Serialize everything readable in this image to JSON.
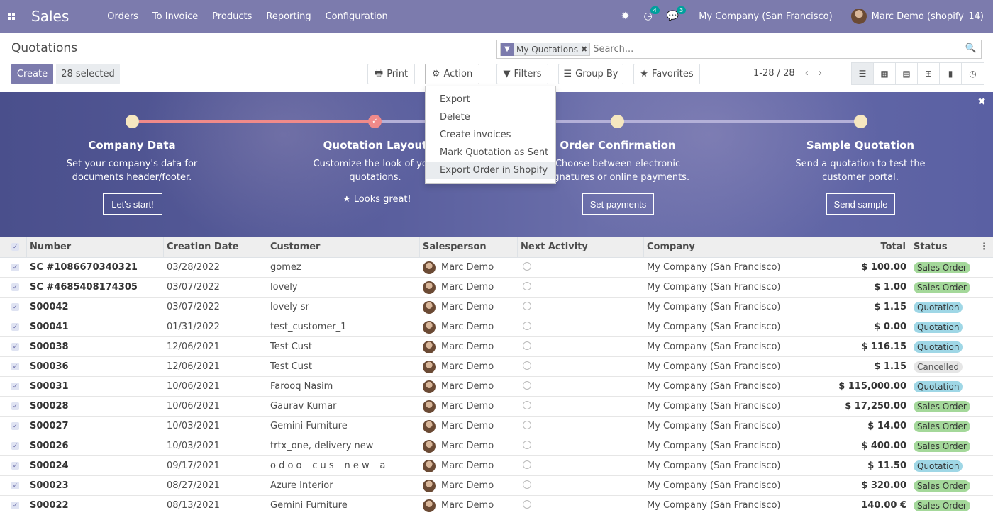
{
  "nav": {
    "app": "Sales",
    "menu": [
      "Orders",
      "To Invoice",
      "Products",
      "Reporting",
      "Configuration"
    ],
    "activity_count": "4",
    "message_count": "3",
    "company": "My Company (San Francisco)",
    "user": "Marc Demo (shopify_14)"
  },
  "control": {
    "title": "Quotations",
    "create": "Create",
    "selected": "28 selected",
    "print": "Print",
    "action": "Action",
    "filters": "Filters",
    "group_by": "Group By",
    "favorites": "Favorites",
    "pager": "1-28 / 28",
    "search_facet": "My Quotations",
    "search_placeholder": "Search..."
  },
  "action_menu": [
    "Export",
    "Delete",
    "Create invoices",
    "Mark Quotation as Sent",
    "Export Order in Shopify"
  ],
  "banner": {
    "steps": [
      {
        "title": "Company Data",
        "desc1": "Set your company's data for",
        "desc2": "documents header/footer.",
        "button": "Let's start!"
      },
      {
        "title": "Quotation Layout",
        "desc1": "Customize the look of your",
        "desc2": "quotations.",
        "done": "Looks great!"
      },
      {
        "title": "Order Confirmation",
        "desc1": "Choose between electronic",
        "desc2": "signatures or online payments.",
        "button": "Set payments"
      },
      {
        "title": "Sample Quotation",
        "desc1": "Send a quotation to test the",
        "desc2": "customer portal.",
        "button": "Send sample"
      }
    ]
  },
  "table": {
    "headers": [
      "Number",
      "Creation Date",
      "Customer",
      "Salesperson",
      "Next Activity",
      "Company",
      "Total",
      "Status"
    ],
    "rows": [
      {
        "number": "SC #1086670340321",
        "date": "03/28/2022",
        "customer": "gomez",
        "salesperson": "Marc Demo",
        "company": "My Company (San Francisco)",
        "total": "$ 100.00",
        "status": "Sales Order"
      },
      {
        "number": "SC #4685408174305",
        "date": "03/07/2022",
        "customer": "lovely",
        "salesperson": "Marc Demo",
        "company": "My Company (San Francisco)",
        "total": "$ 1.00",
        "status": "Sales Order"
      },
      {
        "number": "S00042",
        "date": "03/07/2022",
        "customer": "lovely sr",
        "salesperson": "Marc Demo",
        "company": "My Company (San Francisco)",
        "total": "$ 1.15",
        "status": "Quotation"
      },
      {
        "number": "S00041",
        "date": "01/31/2022",
        "customer": "test_customer_1",
        "salesperson": "Marc Demo",
        "company": "My Company (San Francisco)",
        "total": "$ 0.00",
        "status": "Quotation"
      },
      {
        "number": "S00038",
        "date": "12/06/2021",
        "customer": "Test Cust",
        "salesperson": "Marc Demo",
        "company": "My Company (San Francisco)",
        "total": "$ 116.15",
        "status": "Quotation"
      },
      {
        "number": "S00036",
        "date": "12/06/2021",
        "customer": "Test Cust",
        "salesperson": "Marc Demo",
        "company": "My Company (San Francisco)",
        "total": "$ 1.15",
        "status": "Cancelled"
      },
      {
        "number": "S00031",
        "date": "10/06/2021",
        "customer": "Farooq Nasim",
        "salesperson": "Marc Demo",
        "company": "My Company (San Francisco)",
        "total": "$ 115,000.00",
        "status": "Quotation"
      },
      {
        "number": "S00028",
        "date": "10/06/2021",
        "customer": "Gaurav Kumar",
        "salesperson": "Marc Demo",
        "company": "My Company (San Francisco)",
        "total": "$ 17,250.00",
        "status": "Sales Order"
      },
      {
        "number": "S00027",
        "date": "10/03/2021",
        "customer": "Gemini Furniture",
        "salesperson": "Marc Demo",
        "company": "My Company (San Francisco)",
        "total": "$ 14.00",
        "status": "Sales Order"
      },
      {
        "number": "S00026",
        "date": "10/03/2021",
        "customer": "trtx_one, delivery new",
        "salesperson": "Marc Demo",
        "company": "My Company (San Francisco)",
        "total": "$ 400.00",
        "status": "Sales Order"
      },
      {
        "number": "S00024",
        "date": "09/17/2021",
        "customer": "o d o o _ c u s _ n e w _ a",
        "salesperson": "Marc Demo",
        "company": "My Company (San Francisco)",
        "total": "$ 11.50",
        "status": "Quotation"
      },
      {
        "number": "S00023",
        "date": "08/27/2021",
        "customer": "Azure Interior",
        "salesperson": "Marc Demo",
        "company": "My Company (San Francisco)",
        "total": "$ 320.00",
        "status": "Sales Order"
      },
      {
        "number": "S00022",
        "date": "08/13/2021",
        "customer": "Gemini Furniture",
        "salesperson": "Marc Demo",
        "company": "My Company (San Francisco)",
        "total": "140.00 €",
        "status": "Sales Order"
      }
    ]
  },
  "colors": {
    "brand": "#7c7bad",
    "sales_order": "#a4d89a",
    "quotation": "#9fd7e6",
    "cancelled": "#e6e6e6"
  }
}
